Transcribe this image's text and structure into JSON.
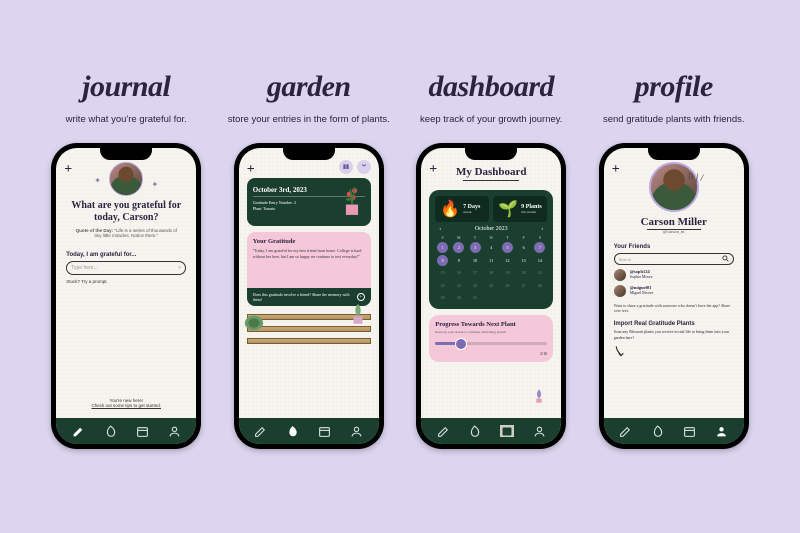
{
  "sections": [
    {
      "title": "journal",
      "sub": "write what you're grateful for."
    },
    {
      "title": "garden",
      "sub": "store your entries in the form of plants."
    },
    {
      "title": "dashboard",
      "sub": "keep track of your growth journey."
    },
    {
      "title": "profile",
      "sub": "send gratitude plants with friends."
    }
  ],
  "journal": {
    "heading": "What are you grateful for today, Carson?",
    "quote_label": "Quote of the Day:",
    "quote": "\"Life is a series of thousands of tiny little miracles. Notice them.\"",
    "prompt_label": "Today, I am grateful for...",
    "placeholder": "Type here...",
    "hint": "Stuck? Try a prompt.",
    "footer1": "You're new here!",
    "footer2": "Check out some tips to get started."
  },
  "garden": {
    "date": "October 3rd, 2023",
    "entry_label": "Gratitude Entry Number:",
    "entry_num": "2",
    "plant_label": "Plant:",
    "plant_name": "Tomato",
    "grat_heading": "Your Gratitude",
    "grat_body": "\"Today, I am grateful for my best friend from home. College is hard without her here, but I am so happy we continue to text everyday!\"",
    "share_prompt": "Does this gratitude involve a friend? Share the memory with them!",
    "share_cta": "+"
  },
  "dashboard": {
    "title": "My Dashboard",
    "stat1_num": "7 Days",
    "stat1_lbl": "streak",
    "stat2_num": "9 Plants",
    "stat2_lbl": "this month",
    "month": "October 2023",
    "days_header": [
      "S",
      "M",
      "T",
      "W",
      "T",
      "F",
      "S"
    ],
    "grid": [
      {
        "n": "1",
        "on": true
      },
      {
        "n": "2",
        "on": true
      },
      {
        "n": "3",
        "on": true
      },
      {
        "n": "4",
        "on": false
      },
      {
        "n": "5",
        "on": true
      },
      {
        "n": "6",
        "on": false
      },
      {
        "n": "7",
        "on": true
      },
      {
        "n": "8",
        "on": true
      },
      {
        "n": "9",
        "on": false
      },
      {
        "n": "10",
        "on": false
      },
      {
        "n": "11",
        "on": false
      },
      {
        "n": "12",
        "on": false
      },
      {
        "n": "13",
        "on": false
      },
      {
        "n": "14",
        "on": false
      },
      {
        "n": "15",
        "on": false,
        "dim": true
      },
      {
        "n": "16",
        "on": false,
        "dim": true
      },
      {
        "n": "17",
        "on": false,
        "dim": true
      },
      {
        "n": "18",
        "on": false,
        "dim": true
      },
      {
        "n": "19",
        "on": false,
        "dim": true
      },
      {
        "n": "20",
        "on": false,
        "dim": true
      },
      {
        "n": "21",
        "on": false,
        "dim": true
      },
      {
        "n": "22",
        "on": false,
        "dim": true
      },
      {
        "n": "23",
        "on": false,
        "dim": true
      },
      {
        "n": "24",
        "on": false,
        "dim": true
      },
      {
        "n": "25",
        "on": false,
        "dim": true
      },
      {
        "n": "26",
        "on": false,
        "dim": true
      },
      {
        "n": "27",
        "on": false,
        "dim": true
      },
      {
        "n": "28",
        "on": false,
        "dim": true
      },
      {
        "n": "29",
        "on": false,
        "dim": true
      },
      {
        "n": "30",
        "on": false,
        "dim": true
      },
      {
        "n": "31",
        "on": false,
        "dim": true
      },
      {
        "n": "",
        "on": false,
        "dim": true
      },
      {
        "n": "",
        "on": false,
        "dim": true
      },
      {
        "n": "",
        "on": false,
        "dim": true
      },
      {
        "n": "",
        "on": false,
        "dim": true
      }
    ],
    "progress_h": "Progress Towards Next Plant",
    "progress_sub": "Keep up your streak to continue cultivating plants!",
    "progress_count": "2/10"
  },
  "profile": {
    "name": "Carson Miller",
    "handle": "@carson_m",
    "friends_h": "Your Friends",
    "search_ph": "Search",
    "friends": [
      {
        "user": "@soph124",
        "name": "Sophia Moore"
      },
      {
        "user": "@miguel01",
        "name": "Miguel Rivera"
      }
    ],
    "share_note": "Want to share a gratitude with someone who doesn't have the app? Share over text.",
    "import_h": "Import Real Gratitude Plants",
    "import_sub": "Scan any Blossom plants you receive in real life to bring them into your garden here!"
  },
  "nav": {
    "items": [
      "pencil",
      "leaf",
      "calendar",
      "person"
    ]
  }
}
